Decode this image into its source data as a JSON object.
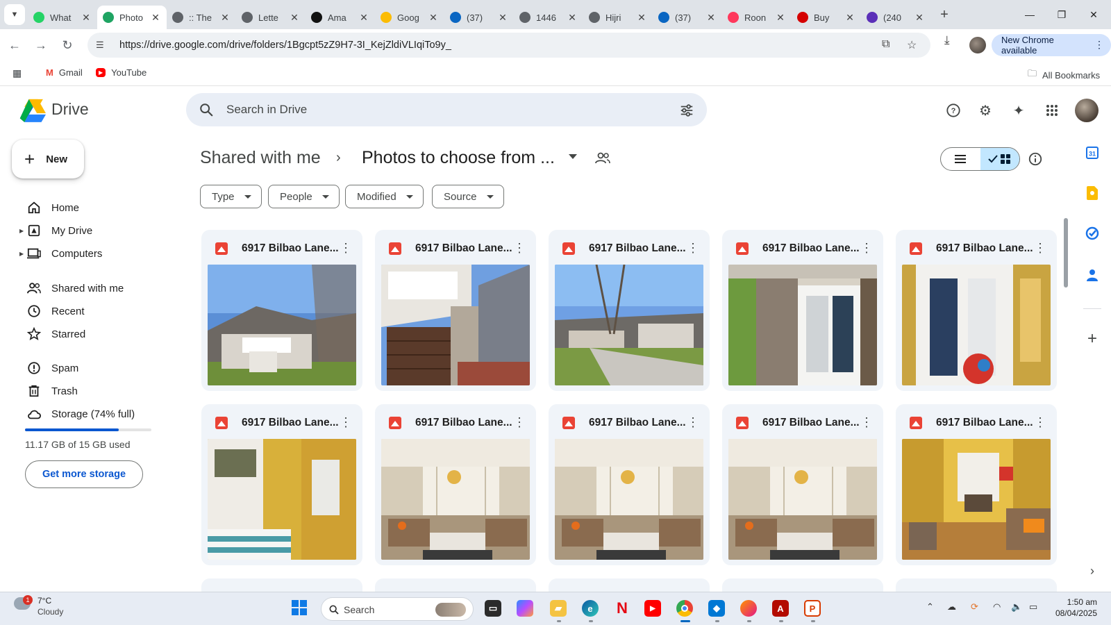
{
  "browser": {
    "tabs": [
      {
        "title": "What",
        "favicon": "whatsapp-icon",
        "color": "#25d366",
        "active": false
      },
      {
        "title": "Photo",
        "favicon": "google-drive-icon",
        "color": "#1fa463",
        "active": true
      },
      {
        "title": ":: The",
        "favicon": "globe-icon",
        "color": "#5f6368",
        "active": false
      },
      {
        "title": "Lette",
        "favicon": "globe-icon",
        "color": "#5f6368",
        "active": false
      },
      {
        "title": "Ama",
        "favicon": "amazon-icon",
        "color": "#111111",
        "active": false
      },
      {
        "title": "Goog",
        "favicon": "google-maps-icon",
        "color": "#fbbc04",
        "active": false
      },
      {
        "title": "(37)",
        "favicon": "linkedin-icon",
        "color": "#0a66c2",
        "active": false
      },
      {
        "title": "1446",
        "favicon": "globe-icon",
        "color": "#5f6368",
        "active": false
      },
      {
        "title": "Hijri",
        "favicon": "globe-icon",
        "color": "#5f6368",
        "active": false
      },
      {
        "title": "(37)",
        "favicon": "linkedin-icon",
        "color": "#0a66c2",
        "active": false
      },
      {
        "title": "Roon",
        "favicon": "airbnb-icon",
        "color": "#ff385c",
        "active": false
      },
      {
        "title": "Buy",
        "favicon": "buy-icon",
        "color": "#d50000",
        "active": false
      },
      {
        "title": "(240",
        "favicon": "mail-icon",
        "color": "#5b2fb8",
        "active": false
      }
    ],
    "url": "https://drive.google.com/drive/folders/1Bgcpt5zZ9H7-3I_KejZldiVLIqiTo9y_",
    "new_chrome_label": "New Chrome available",
    "bookmarks": [
      {
        "label": "Gmail",
        "icon": "gmail-icon"
      },
      {
        "label": "YouTube",
        "icon": "youtube-icon"
      }
    ],
    "all_bookmarks_label": "All Bookmarks"
  },
  "drive": {
    "app_name": "Drive",
    "search_placeholder": "Search in Drive",
    "new_label": "New",
    "nav": [
      {
        "label": "Home",
        "icon": "home-icon",
        "expandable": false
      },
      {
        "label": "My Drive",
        "icon": "my-drive-icon",
        "expandable": true
      },
      {
        "label": "Computers",
        "icon": "computers-icon",
        "expandable": true
      },
      {
        "label": "Shared with me",
        "icon": "shared-icon",
        "expandable": false
      },
      {
        "label": "Recent",
        "icon": "clock-icon",
        "expandable": false
      },
      {
        "label": "Starred",
        "icon": "star-icon",
        "expandable": false
      },
      {
        "label": "Spam",
        "icon": "spam-icon",
        "expandable": false
      },
      {
        "label": "Trash",
        "icon": "trash-icon",
        "expandable": false
      },
      {
        "label": "Storage (74% full)",
        "icon": "cloud-icon",
        "expandable": false
      }
    ],
    "storage": {
      "used_text": "11.17 GB of 15 GB used",
      "fraction": 0.74,
      "button_label": "Get more storage"
    },
    "breadcrumb": {
      "parent": "Shared with me",
      "current": "Photos to choose from ..."
    },
    "filters": [
      "Type",
      "People",
      "Modified",
      "Source"
    ],
    "files": [
      {
        "name": "6917 Bilbao Lane...",
        "thumb": "exterior-front"
      },
      {
        "name": "6917 Bilbao Lane...",
        "thumb": "garage"
      },
      {
        "name": "6917 Bilbao Lane...",
        "thumb": "street"
      },
      {
        "name": "6917 Bilbao Lane...",
        "thumb": "entry-door"
      },
      {
        "name": "6917 Bilbao Lane...",
        "thumb": "interior-door"
      },
      {
        "name": "6917 Bilbao Lane...",
        "thumb": "hallway-stairs"
      },
      {
        "name": "6917 Bilbao Lane...",
        "thumb": "living-room"
      },
      {
        "name": "6917 Bilbao Lane...",
        "thumb": "living-room"
      },
      {
        "name": "6917 Bilbao Lane...",
        "thumb": "living-room"
      },
      {
        "name": "6917 Bilbao Lane...",
        "thumb": "living-dining"
      }
    ]
  },
  "taskbar": {
    "weather": {
      "temp": "7°C",
      "condition": "Cloudy",
      "badge": "1"
    },
    "search_label": "Search",
    "time": "1:50 am",
    "date": "08/04/2025"
  },
  "colors": {
    "accent": "#0b57d0",
    "selected_view": "#c2e7ff",
    "surface": "#f0f4f9"
  }
}
